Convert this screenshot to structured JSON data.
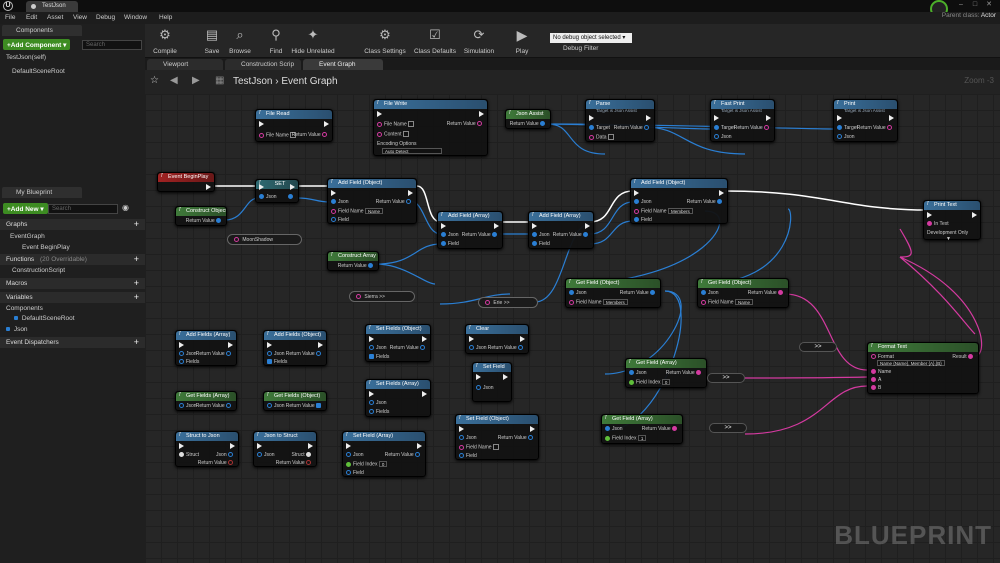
{
  "window": {
    "tab_title": "TestJson",
    "parent_class_label": "Parent class:",
    "parent_class_value": "Actor"
  },
  "menu": [
    "File",
    "Edit",
    "Asset",
    "View",
    "Debug",
    "Window",
    "Help"
  ],
  "toolbar": {
    "compile": "Compile",
    "save": "Save",
    "browse": "Browse",
    "find": "Find",
    "hide_unrelated": "Hide Unrelated",
    "class_settings": "Class Settings",
    "class_defaults": "Class Defaults",
    "simulation": "Simulation",
    "play": "Play",
    "debug_select": "No debug object selected ▾",
    "debug_filter": "Debug Filter"
  },
  "components_panel": {
    "tab": "Components",
    "add_button": "+Add Component ▾",
    "search_placeholder": "Search",
    "items": [
      "TestJson(self)",
      "DefaultSceneRoot"
    ]
  },
  "my_blueprint": {
    "tab": "My Blueprint",
    "add_button": "+Add New ▾",
    "search_placeholder": "Search",
    "graphs_header": "Graphs",
    "event_graph": "EventGraph",
    "event_begin_play": "Event BeginPlay",
    "functions_header": "Functions",
    "functions_note": "(20 Overridable)",
    "construction_script": "ConstructionScript",
    "macros_header": "Macros",
    "variables_header": "Variables",
    "components_header": "Components",
    "var_default_scene_root": "DefaultSceneRoot",
    "var_json": "Json",
    "event_dispatchers_header": "Event Dispatchers"
  },
  "doc_tabs": [
    "Viewport",
    "Construction Scrip",
    "Event Graph"
  ],
  "graph": {
    "breadcrumb_root": "TestJson",
    "breadcrumb_sep": "›",
    "breadcrumb_graph": "Event Graph",
    "zoom": "Zoom -3",
    "watermark": "BLUEPRINT"
  },
  "nodes": {
    "file_read": {
      "title": "File Read",
      "file_name": "File Name",
      "return_value": "Return Value"
    },
    "file_write": {
      "title": "File Write",
      "file_name": "File Name",
      "content": "Content",
      "encoding": "Encoding Options",
      "encoding_value": "Auto Detect",
      "return_value": "Return Value"
    },
    "json_assist": {
      "title": "Json Assist",
      "return_value": "Return Value"
    },
    "parse": {
      "title": "Parse",
      "sub": "Target is Json Assist",
      "target": "Target",
      "data": "Data",
      "return_value": "Return Value"
    },
    "fast_print": {
      "title": "Fast Print",
      "sub": "Target is Json Assist",
      "target": "Target",
      "json": "Json",
      "return_value": "Return Value"
    },
    "print": {
      "title": "Print",
      "sub": "Target is Json Assist",
      "target": "Target",
      "json": "Json",
      "return_value": "Return Value"
    },
    "event_begin_play": {
      "title": "Event BeginPlay"
    },
    "set": {
      "title": "SET",
      "json": "Json"
    },
    "add_field_object_1": {
      "title": "Add Field (Object)",
      "json": "Json",
      "field_name": "Field Name",
      "field_name_value": "Name",
      "field": "Field",
      "return_value": "Return Value"
    },
    "add_field_array_1": {
      "title": "Add Field (Array)",
      "json": "Json",
      "field": "Field",
      "return_value": "Return Value"
    },
    "add_field_array_2": {
      "title": "Add Field (Array)",
      "json": "Json",
      "field": "Field",
      "return_value": "Return Value"
    },
    "add_field_object_2": {
      "title": "Add Field (Object)",
      "json": "Json",
      "field_name": "Field Name",
      "field_name_value": "Members",
      "field": "Field",
      "return_value": "Return Value"
    },
    "print_text": {
      "title": "Print Text",
      "in_text": "In Text",
      "dev_only": "Development Only"
    },
    "construct_object": {
      "title": "Construct Object",
      "return_value": "Return Value"
    },
    "construct_array": {
      "title": "Construct Array",
      "return_value": "Return Value"
    },
    "pill_moonshadow": "MoonShadow",
    "pill_sierra": "Sierra",
    "pill_erie": "Erie",
    "get_field_object_1": {
      "title": "Get Field (Object)",
      "json": "Json",
      "field_name": "Field Name",
      "field_name_value": "Members",
      "return_value": "Return Value"
    },
    "get_field_object_2": {
      "title": "Get Field (Object)",
      "json": "Json",
      "field_name": "Field Name",
      "field_name_value": "Name",
      "return_value": "Return Value"
    },
    "get_field_array_1": {
      "title": "Get Field (Array)",
      "json": "Json",
      "field_index": "Field Index",
      "field_index_value": "0",
      "return_value": "Return Value"
    },
    "get_field_array_2": {
      "title": "Get Field (Array)",
      "json": "Json",
      "field_index": "Field Index",
      "field_index_value": "1",
      "return_value": "Return Value"
    },
    "format_text": {
      "title": "Format Text",
      "format": "Format",
      "format_value": "Name {Name}, Member {A},{B}",
      "name": "Name",
      "a": "A",
      "b": "B",
      "result": "Result"
    },
    "reroute_label": ">>",
    "add_fields_array": {
      "title": "Add Fields (Array)",
      "json": "Json",
      "fields": "Fields",
      "return_value": "Return Value"
    },
    "add_fields_object": {
      "title": "Add Fields (Object)",
      "json": "Json",
      "fields": "Fields",
      "return_value": "Return Value"
    },
    "set_fields_object": {
      "title": "Set Fields (Object)",
      "json": "Json",
      "fields": "Fields",
      "return_value": "Return Value"
    },
    "set_fields_array": {
      "title": "Set Fields (Array)",
      "json": "Json",
      "fields": "Fields"
    },
    "clear": {
      "title": "Clear",
      "json": "Json",
      "return_value": "Return Value"
    },
    "set_field": {
      "title": "Set Field",
      "json": "Json"
    },
    "get_fields_array": {
      "title": "Get Fields (Array)",
      "json": "Json",
      "return_value": "Return Value"
    },
    "get_fields_object": {
      "title": "Get Fields (Object)",
      "json": "Json",
      "return_value": "Return Value"
    },
    "set_field_object": {
      "title": "Set Field (Object)",
      "json": "Json",
      "field_name": "Field Name",
      "field": "Field",
      "return_value": "Return Value"
    },
    "struct_to_json": {
      "title": "Struct to Json",
      "struct": "Struct",
      "json": "Json",
      "return_value": "Return Value"
    },
    "json_to_struct": {
      "title": "Json to Struct",
      "json": "Json",
      "struct": "Struct",
      "return_value": "Return Value"
    },
    "set_field_array": {
      "title": "Set Field (Array)",
      "json": "Json",
      "field_index": "Field Index",
      "field_index_value": "0",
      "field": "Field",
      "return_value": "Return Value"
    }
  },
  "colors": {
    "function_header": "#3a6f9a",
    "pure_header": "#3f7a3a",
    "event_header": "#a02222",
    "json_pin": "#2a7fd4",
    "text_pin": "#d43aa0",
    "exec_wire": "#ffffff",
    "accent_green": "#3d8c22"
  }
}
